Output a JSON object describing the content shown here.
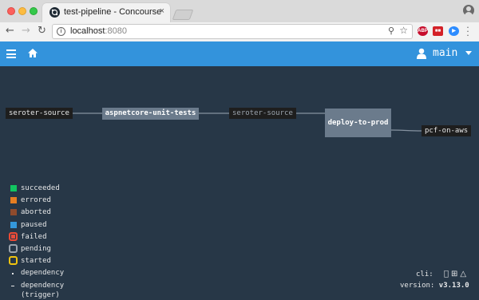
{
  "browser": {
    "tab_title": "test-pipeline - Concourse",
    "tab_close": "×",
    "url_host": "localhost",
    "url_port": ":8080",
    "info_glyph": "i",
    "ext_abp": "ABP",
    "ext_2": "",
    "ext_3": ""
  },
  "appbar": {
    "team_name": "main",
    "accent_color": "#3393dc"
  },
  "pipeline": {
    "resources": [
      {
        "name": "seroter-source"
      },
      {
        "name": "seroter-source"
      },
      {
        "name": "pcf-on-aws"
      }
    ],
    "jobs": [
      {
        "name": "aspnetcore-unit-tests"
      },
      {
        "name": "deploy-to-prod"
      }
    ]
  },
  "legend": [
    {
      "label": "succeeded",
      "color": "#11c560",
      "style": "fill"
    },
    {
      "label": "errored",
      "color": "#e67e22",
      "style": "fill"
    },
    {
      "label": "aborted",
      "color": "#8f4b2d",
      "style": "fill"
    },
    {
      "label": "paused",
      "color": "#3498db",
      "style": "fill"
    },
    {
      "label": "failed",
      "color": "#ed4b35",
      "style": "outline-fill"
    },
    {
      "label": "pending",
      "color": "#9aa3ad",
      "style": "outline"
    },
    {
      "label": "started",
      "color": "#f1c40f",
      "style": "outline"
    },
    {
      "label": "dependency",
      "style": "dot"
    },
    {
      "label": "dependency (trigger)",
      "style": "dash"
    }
  ],
  "footer": {
    "cli_label": "cli:",
    "version_label": "version:",
    "version_value": "v3.13.0"
  }
}
